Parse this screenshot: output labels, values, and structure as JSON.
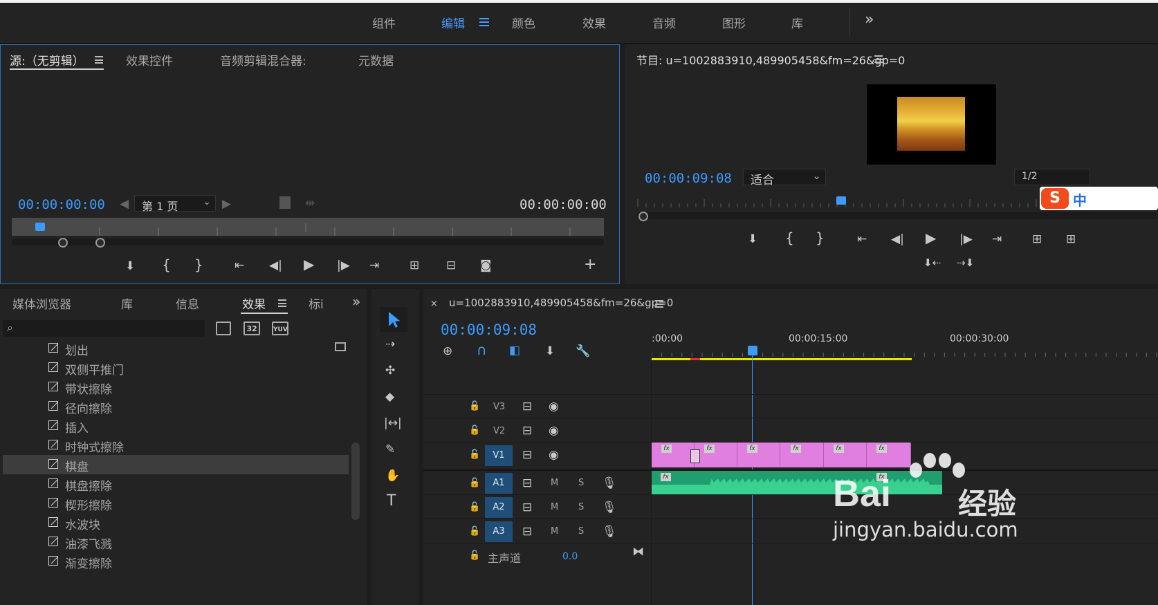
{
  "workspaces": {
    "items": [
      "组件",
      "编辑",
      "颜色",
      "效果",
      "音频",
      "图形",
      "库"
    ],
    "active": "编辑",
    "more": "»"
  },
  "source_panel": {
    "tabs": [
      "源:（无剪辑）",
      "效果控件",
      "音频剪辑混合器:",
      "元数据"
    ],
    "timecode_left": "00:00:00:00",
    "timecode_right": "00:00:00:00",
    "page_select": "第 1 页"
  },
  "program_panel": {
    "title": "节目: u=1002883910,489905458&fm=26&gp=0",
    "timecode": "00:00:09:08",
    "fit_select": "适合",
    "resolution": "1/2"
  },
  "project_panel": {
    "tabs": [
      "媒体浏览器",
      "库",
      "信息",
      "效果",
      "标i"
    ],
    "active_tab": "效果",
    "search_placeholder": "",
    "badges": [
      "32",
      "YUV"
    ],
    "effects": [
      "划出",
      "双侧平推门",
      "带状擦除",
      "径向擦除",
      "插入",
      "时钟式擦除",
      "棋盘",
      "棋盘擦除",
      "楔形擦除",
      "水波块",
      "油漆飞溅",
      "渐变擦除"
    ],
    "selected_effect": "棋盘"
  },
  "timeline": {
    "title": "u=1002883910,489905458&fm=26&gp=0",
    "timecode": "00:00:09:08",
    "ruler": [
      ":00:00",
      "00:00:15:00",
      "00:00:30:00"
    ],
    "tracks": {
      "video": [
        {
          "name": "V3",
          "target": false
        },
        {
          "name": "V2",
          "target": false
        },
        {
          "name": "V1",
          "target": true
        }
      ],
      "audio": [
        {
          "name": "A1",
          "m": "M",
          "s": "S"
        },
        {
          "name": "A2",
          "m": "M",
          "s": "S"
        },
        {
          "name": "A3",
          "m": "M",
          "s": "S"
        }
      ],
      "master_label": "主声道",
      "master_value": "0.0"
    },
    "clip_label": "fx"
  },
  "watermark": {
    "brand": "Bai",
    "brand2": "经验",
    "url": "jingyan.baidu.com"
  },
  "ime_badge": "中",
  "colors": {
    "accent": "#3c9bff",
    "clip_video": "#e07fe0",
    "clip_audio": "#1f9e70",
    "track_target": "#1f4f78",
    "work_area": "#e6e600"
  }
}
